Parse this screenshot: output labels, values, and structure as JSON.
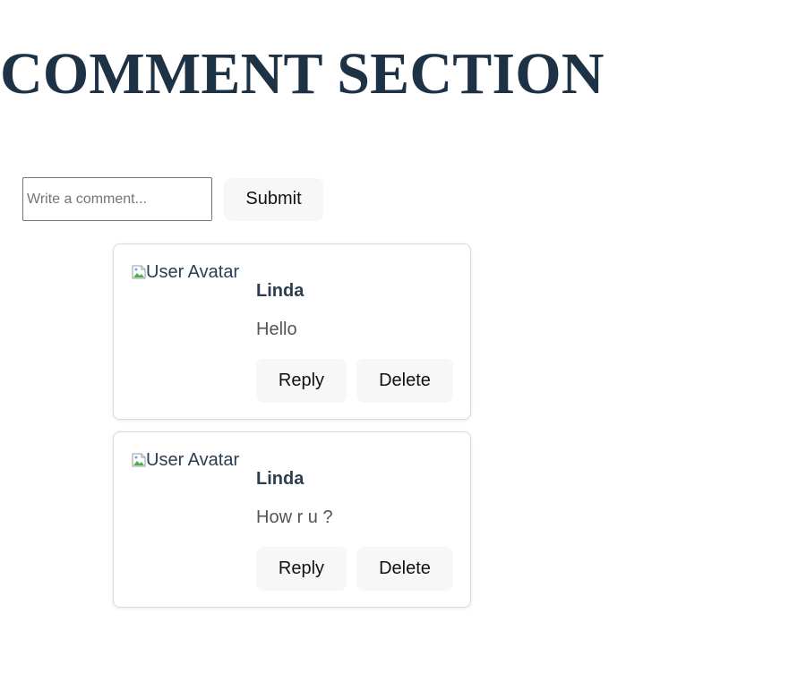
{
  "page": {
    "title": "COMMENT SECTION"
  },
  "form": {
    "input_value": "",
    "input_placeholder": "Write a comment...",
    "submit_label": "Submit"
  },
  "comments": [
    {
      "avatar_alt": "User Avatar",
      "author": "Linda",
      "text": "Hello",
      "reply_label": "Reply",
      "delete_label": "Delete"
    },
    {
      "avatar_alt": "User Avatar",
      "author": "Linda",
      "text": "How r u ?",
      "reply_label": "Reply",
      "delete_label": "Delete"
    }
  ],
  "icons": {
    "avatar_placeholder": "broken-image-icon"
  },
  "colors": {
    "title": "#1e3246",
    "author": "#2c3e50",
    "comment_text": "#555555",
    "button_bg": "#f7f7f7",
    "card_border": "#dadada"
  }
}
